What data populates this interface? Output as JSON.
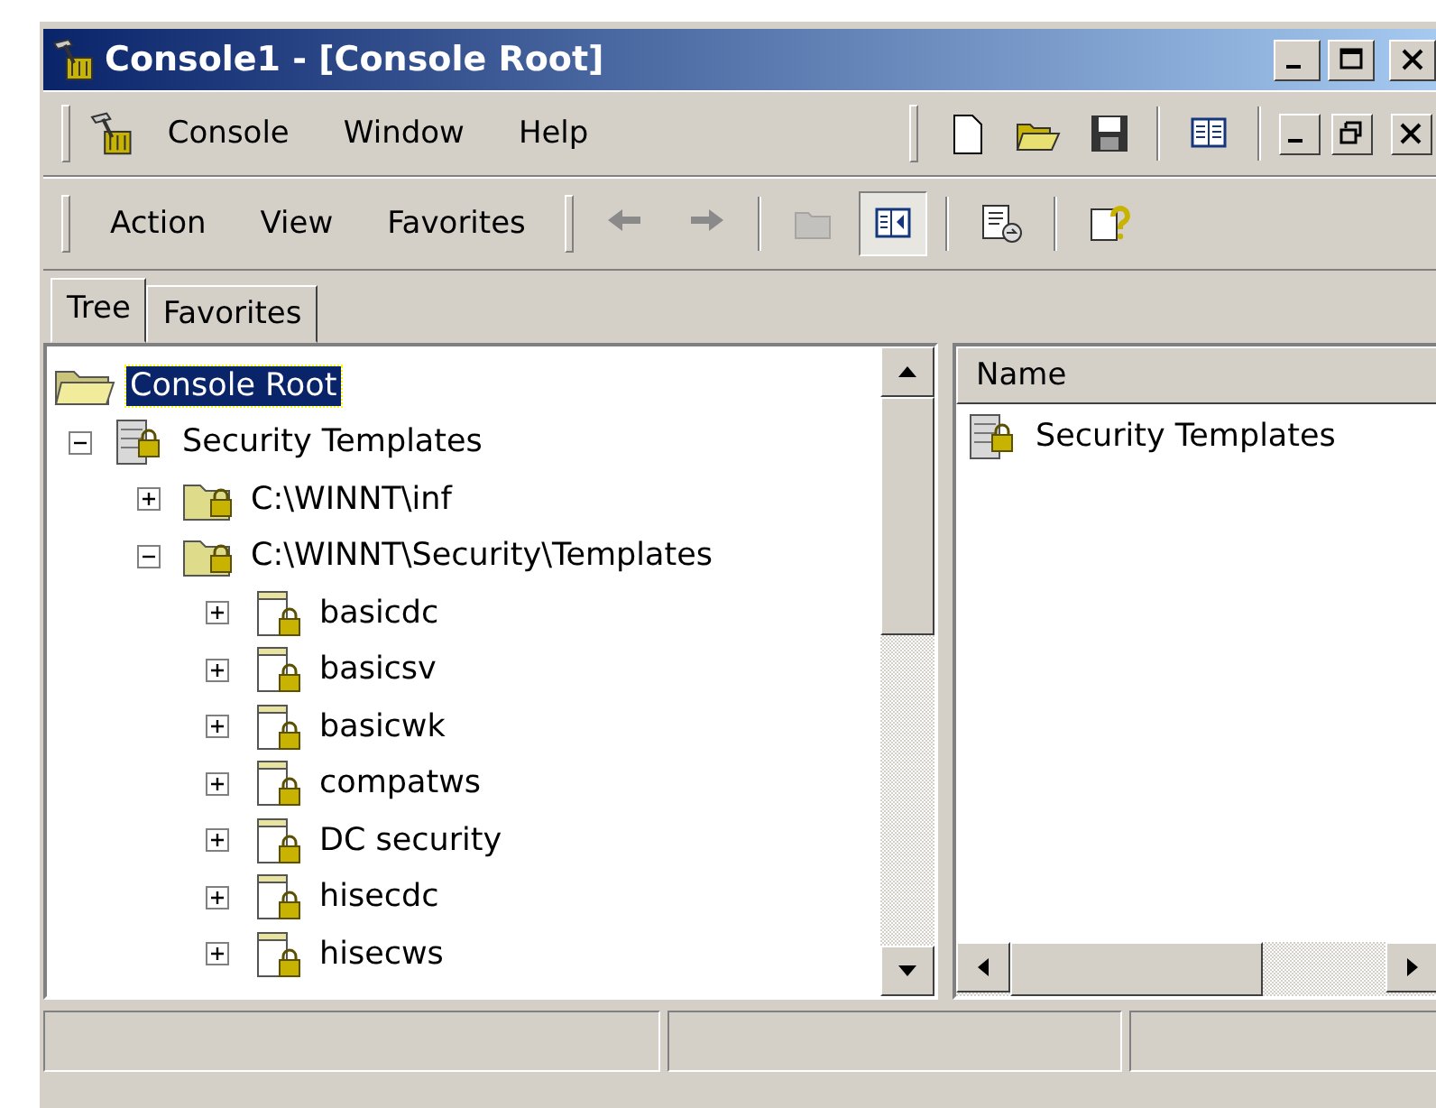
{
  "window": {
    "title": "Console1 - [Console Root]"
  },
  "menu": [
    "Console",
    "Window",
    "Help"
  ],
  "toolbar_menu": [
    "Action",
    "View",
    "Favorites"
  ],
  "toolbar": [
    {
      "kind": "back",
      "disabled": false
    },
    {
      "kind": "forward",
      "disabled": false
    },
    {
      "kind": "up",
      "disabled": true
    },
    {
      "kind": "tree-toggle",
      "pressed": true
    },
    {
      "kind": "export",
      "disabled": false
    },
    {
      "kind": "help",
      "disabled": false
    }
  ],
  "tabs": [
    {
      "label": "Tree",
      "selected": true
    },
    {
      "label": "Favorites",
      "selected": false
    }
  ],
  "tree": [
    {
      "label": "Console Root",
      "kind": "root",
      "selected": true,
      "children": [
        {
          "label": "Security Templates",
          "kind": "store",
          "selected": false,
          "expanded": true,
          "children": [
            {
              "label": "C:\\WINNT\\inf",
              "kind": "folder",
              "selected": false,
              "expanded": false
            },
            {
              "label": "C:\\WINNT\\Security\\Templates",
              "kind": "folder",
              "selected": false,
              "expanded": true,
              "children": [
                {
                  "label": "basicdc",
                  "kind": "template",
                  "selected": false,
                  "expanded": false
                },
                {
                  "label": "basicsv",
                  "kind": "template",
                  "selected": false,
                  "expanded": false
                },
                {
                  "label": "basicwk",
                  "kind": "template",
                  "selected": false,
                  "expanded": false
                },
                {
                  "label": "compatws",
                  "kind": "template",
                  "selected": false,
                  "expanded": false
                },
                {
                  "label": "DC security",
                  "kind": "template",
                  "selected": false,
                  "expanded": false
                },
                {
                  "label": "hisecdc",
                  "kind": "template",
                  "selected": false,
                  "expanded": false
                },
                {
                  "label": "hisecws",
                  "kind": "template",
                  "selected": false,
                  "expanded": false
                }
              ]
            }
          ]
        }
      ]
    }
  ],
  "list": {
    "columns": [
      "Name"
    ],
    "rows": [
      {
        "name": "Security Templates",
        "kind": "store",
        "selected": false
      }
    ]
  }
}
